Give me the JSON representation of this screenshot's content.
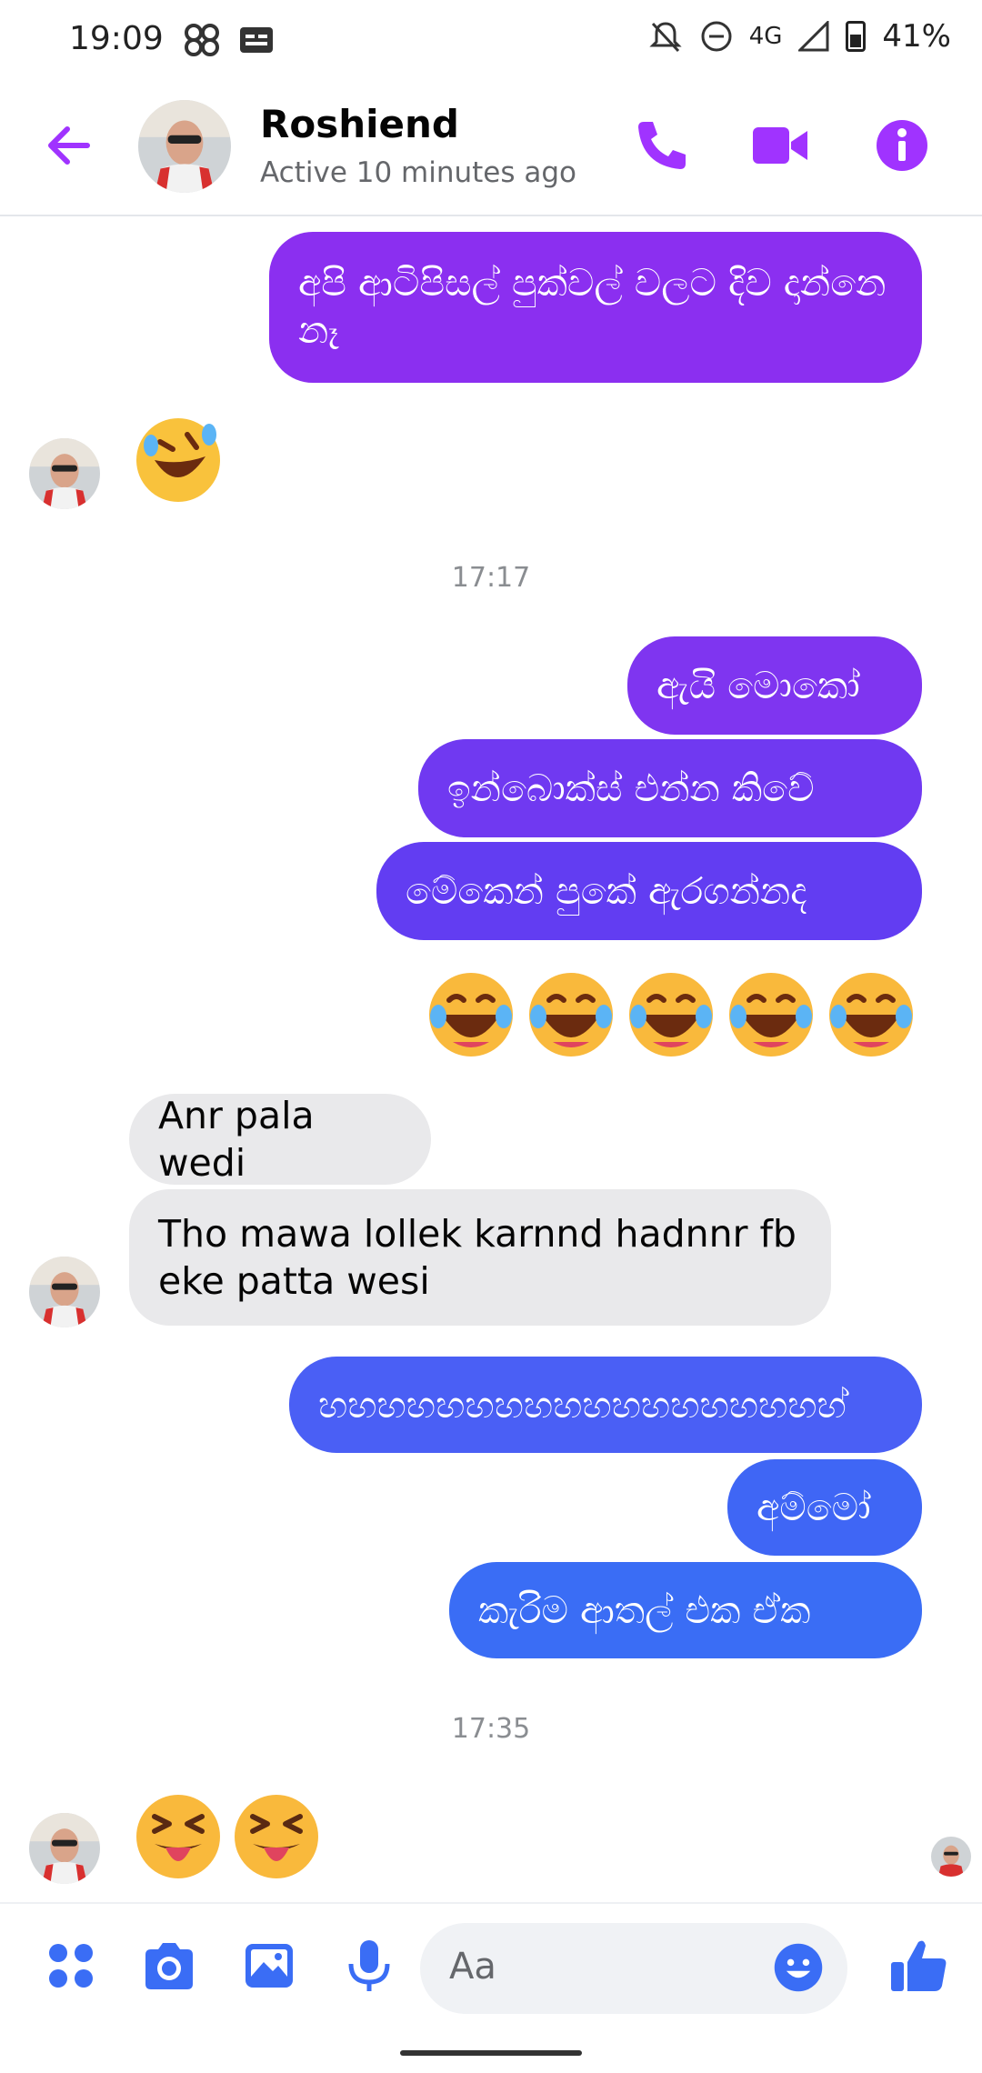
{
  "status_bar": {
    "time": "19:09",
    "network": "4G",
    "battery": "41%"
  },
  "header": {
    "contact_name": "Roshiend",
    "active_status": "Active 10 minutes ago"
  },
  "messages": [
    {
      "text": "අපි ආටිපිසල් පුක්වල් වලට දිව දාන්නෙ නෑ",
      "dir": "out"
    },
    {
      "text": "ඇයි මොකෝ",
      "dir": "out"
    },
    {
      "text": "ඉන්බොක්ස් එන්න කිවේ",
      "dir": "out"
    },
    {
      "text": "මේකෙන් පුකේ ඇරගන්නද",
      "dir": "out"
    },
    {
      "text": "Anr pala wedi",
      "dir": "in"
    },
    {
      "text": "Tho mawa lollek karnnd hadnnr fb eke patta wesi",
      "dir": "in"
    },
    {
      "text": "හහහහහහහහහහහහහහහහහහ්",
      "dir": "out"
    },
    {
      "text": "අම්මෝ",
      "dir": "out"
    },
    {
      "text": "කැරිම ආතල් එක ඒක",
      "dir": "out"
    }
  ],
  "timestamps": [
    "17:17",
    "17:35"
  ],
  "composer": {
    "placeholder": "Aa"
  },
  "colors": {
    "accent": "#a033ff",
    "purple_bubble": "#8b2ff0",
    "blue_bubble": "#3a6df5",
    "incoming": "#e9e9eb"
  },
  "icons": [
    "back-arrow-icon",
    "phone-icon",
    "video-camera-icon",
    "info-icon",
    "apps-icon",
    "camera-icon",
    "gallery-icon",
    "microphone-icon",
    "emoji-icon",
    "thumbs-up-icon"
  ]
}
